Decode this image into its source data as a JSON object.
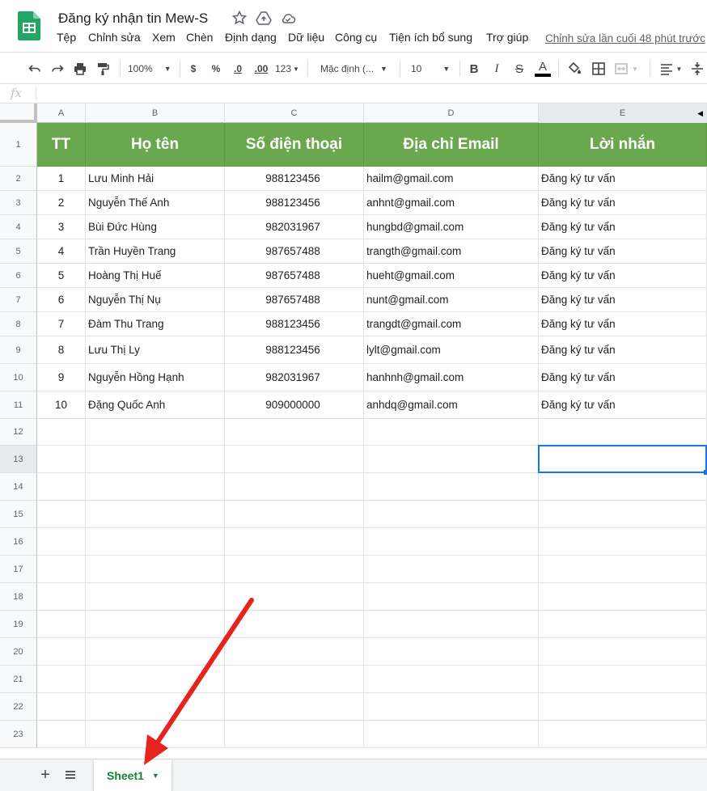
{
  "app": {
    "title": "Đăng ký nhận tin Mew-S"
  },
  "menu": [
    "Tệp",
    "Chỉnh sửa",
    "Xem",
    "Chèn",
    "Định dạng",
    "Dữ liệu",
    "Công cụ",
    "Tiện ích bổ sung",
    "Trợ giúp"
  ],
  "last_edit": "Chỉnh sửa lần cuối 48 phút trước",
  "toolbar": {
    "zoom": "100%",
    "currency": "$",
    "percent": "%",
    "dec_dec": ".0",
    "dec_inc": ".00",
    "number_format": "123",
    "font": "Mặc định (...",
    "font_size": "10",
    "bold": "B",
    "italic": "I",
    "strike": "S",
    "text_color": "A"
  },
  "formula_bar": {
    "label": "fx",
    "value": ""
  },
  "columns": [
    "A",
    "B",
    "C",
    "D",
    "E"
  ],
  "rows": [
    "1",
    "2",
    "3",
    "4",
    "5",
    "6",
    "7",
    "8",
    "9",
    "10",
    "11",
    "12",
    "13",
    "14",
    "15",
    "16",
    "17",
    "18",
    "19",
    "20",
    "21",
    "22",
    "23"
  ],
  "table_header": [
    "TT",
    "Họ tên",
    "Số điện thoại",
    "Địa chỉ Email",
    "Lời nhắn"
  ],
  "table_rows": [
    [
      "1",
      "Lưu Minh Hải",
      "988123456",
      "hailm@gmail.com",
      "Đăng ký tư vấn"
    ],
    [
      "2",
      "Nguyễn Thế Anh",
      "988123456",
      "anhnt@gmail.com",
      "Đăng ký tư vấn"
    ],
    [
      "3",
      "Bùi Đức Hùng",
      "982031967",
      "hungbd@gmail.com",
      "Đăng ký tư vấn"
    ],
    [
      "4",
      "Trần Huyền Trang",
      "987657488",
      "trangth@gmail.com",
      "Đăng ký tư vấn"
    ],
    [
      "5",
      "Hoàng Thị Huế",
      "987657488",
      "hueht@gmail.com",
      "Đăng ký tư vấn"
    ],
    [
      "6",
      "Nguyễn Thị Nụ",
      "987657488",
      "nunt@gmail.com",
      "Đăng ký tư vấn"
    ],
    [
      "7",
      "Đàm Thu Trang",
      "988123456",
      "trangdt@gmail.com",
      "Đăng ký tư vấn"
    ],
    [
      "8",
      "Lưu Thị Ly",
      "988123456",
      "lylt@gmail.com",
      "Đăng ký tư vấn"
    ],
    [
      "9",
      "Nguyễn Hồng Hạnh",
      "982031967",
      "hanhnh@gmail.com",
      "Đăng ký tư vấn"
    ],
    [
      "10",
      "Đặng Quốc Anh",
      "909000000",
      "anhdq@gmail.com",
      "Đăng ký tư vấn"
    ]
  ],
  "sheet_tab": {
    "label": "Sheet1"
  },
  "colors": {
    "header_green": "#6aa84f",
    "selection_blue": "#1a73e8",
    "tab_green": "#188038",
    "arrow_red": "#e8221c"
  }
}
